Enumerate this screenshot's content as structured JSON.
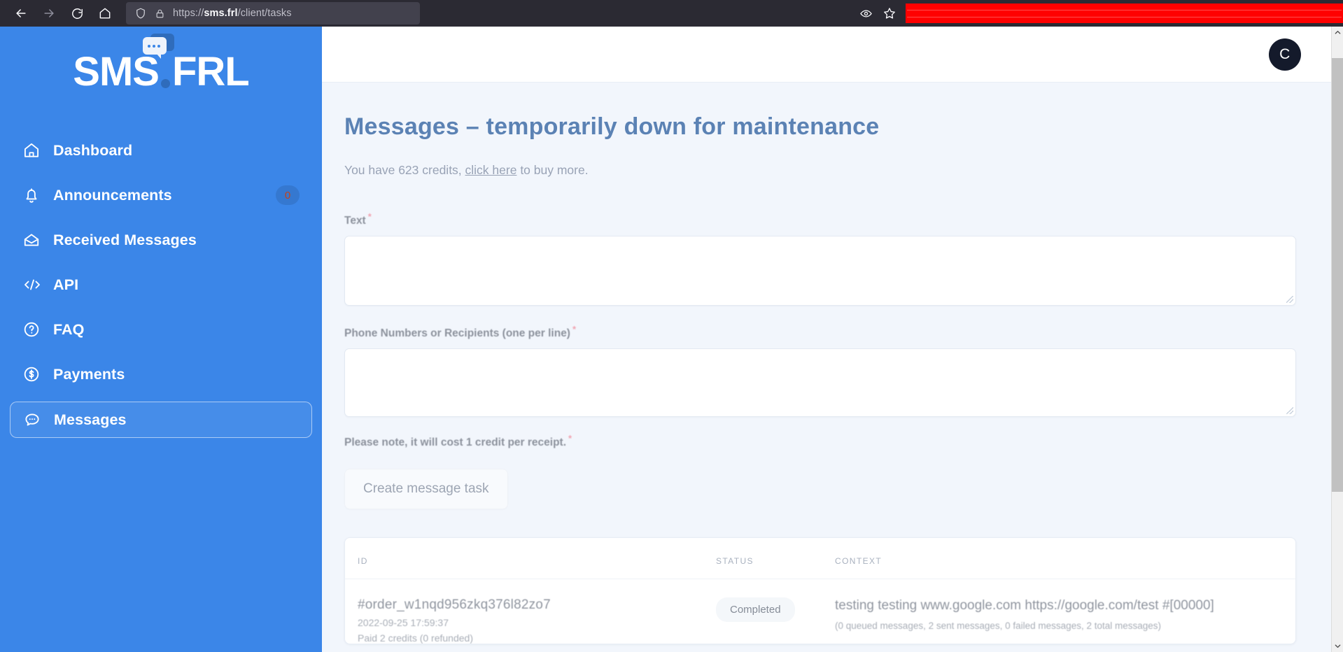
{
  "browser": {
    "back_icon": "arrow-left-icon",
    "forward_icon": "arrow-right-icon",
    "reload_icon": "reload-icon",
    "home_icon": "home-icon",
    "shield_icon": "shield-icon",
    "lock_icon": "lock-icon",
    "url_prefix": "https://",
    "url_host": "sms.frl",
    "url_path": "/client/tasks",
    "reader_icon": "eye-icon",
    "bookmark_icon": "star-icon"
  },
  "sidebar": {
    "logo": {
      "text_a": "SMS",
      "text_b": "FRL",
      "bubble_icon": "chat-bubble-icon"
    },
    "items": [
      {
        "label": "Dashboard",
        "icon": "home-icon",
        "badge": null,
        "active": false
      },
      {
        "label": "Announcements",
        "icon": "bell-icon",
        "badge": "0",
        "active": false
      },
      {
        "label": "Received Messages",
        "icon": "open-envelope-icon",
        "badge": null,
        "active": false
      },
      {
        "label": "API",
        "icon": "code-icon",
        "badge": null,
        "active": false
      },
      {
        "label": "FAQ",
        "icon": "question-circle-icon",
        "badge": null,
        "active": false
      },
      {
        "label": "Payments",
        "icon": "dollar-circle-icon",
        "badge": null,
        "active": false
      },
      {
        "label": "Messages",
        "icon": "chat-bubble-icon",
        "badge": null,
        "active": true
      }
    ]
  },
  "topbar": {
    "avatar_initial": "C"
  },
  "main": {
    "page_title": "Messages – temporarily down for maintenance",
    "credits": {
      "before": "You have 623 credits, ",
      "link": "click here",
      "after": " to buy more.",
      "amount": "623"
    },
    "form": {
      "text_label": "Text",
      "text_value": "",
      "recipients_label": "Phone Numbers or Recipients (one per line)",
      "recipients_value": "",
      "note_label": "Please note, it will cost 1 credit per receipt.",
      "required_marker": "*",
      "submit_label": "Create message task"
    },
    "table": {
      "headers": [
        "ID",
        "STATUS",
        "CONTEXT"
      ],
      "rows": [
        {
          "id": "#order_w1nqd956zkq376l82zo7",
          "timestamp": "2022-09-25 17:59:37",
          "credits": "Paid 2 credits (0 refunded)",
          "status": "Completed",
          "context": "testing testing www.google.com https://google.com/test #[00000]",
          "context_counts": "(0 queued messages, 2 sent messages, 0 failed messages, 2 total messages)"
        }
      ]
    }
  },
  "colors": {
    "sidebar_blue": "#3b86e8",
    "title_blue": "#5b82b4",
    "page_bg": "#f2f6fc",
    "required_red": "#ef5a6e",
    "avatar_dark": "#141a2b",
    "badge_text": "#c3441c"
  }
}
